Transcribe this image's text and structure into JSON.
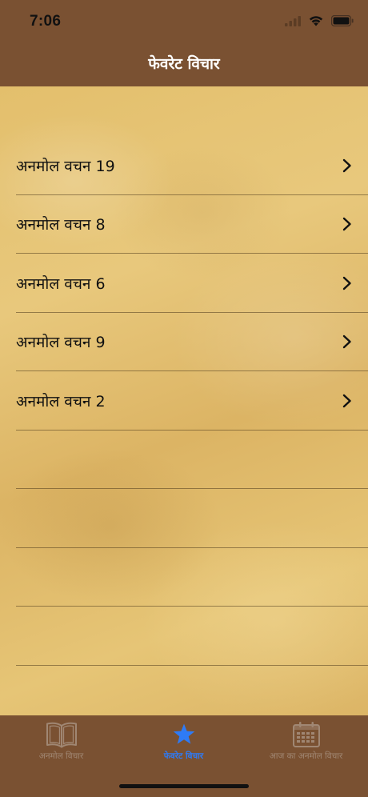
{
  "status_bar": {
    "time": "7:06",
    "icons": [
      "signal-icon",
      "wifi-icon",
      "battery-icon"
    ]
  },
  "nav": {
    "title": "फेवरेट विचार"
  },
  "list": {
    "items": [
      {
        "label": "अनमोल वचन 19"
      },
      {
        "label": "अनमोल वचन 8"
      },
      {
        "label": "अनमोल वचन 6"
      },
      {
        "label": "अनमोल वचन 9"
      },
      {
        "label": "अनमोल वचन 2"
      }
    ],
    "empty_rows": 4
  },
  "tabs": [
    {
      "label": "अनमोल विचार",
      "icon": "book-icon",
      "active": false
    },
    {
      "label": "फेवरेट विचार",
      "icon": "star-icon",
      "active": true
    },
    {
      "label": "आज का अनमोल विचार",
      "icon": "calendar-icon",
      "active": false
    }
  ],
  "colors": {
    "brown_bar": "#7a5132",
    "active_tab": "#2e7bf6",
    "inactive_tab": "#a08773",
    "paper": "#e3bf6c"
  }
}
